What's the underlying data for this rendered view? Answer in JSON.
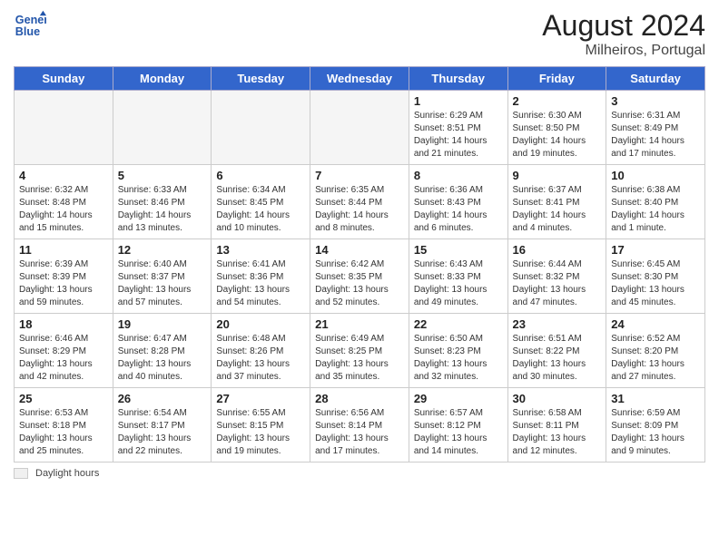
{
  "header": {
    "logo_line1": "General",
    "logo_line2": "Blue",
    "month_year": "August 2024",
    "location": "Milheiros, Portugal"
  },
  "days_of_week": [
    "Sunday",
    "Monday",
    "Tuesday",
    "Wednesday",
    "Thursday",
    "Friday",
    "Saturday"
  ],
  "weeks": [
    [
      {
        "num": "",
        "info": "",
        "empty": true
      },
      {
        "num": "",
        "info": "",
        "empty": true
      },
      {
        "num": "",
        "info": "",
        "empty": true
      },
      {
        "num": "",
        "info": "",
        "empty": true
      },
      {
        "num": "1",
        "info": "Sunrise: 6:29 AM\nSunset: 8:51 PM\nDaylight: 14 hours\nand 21 minutes.",
        "empty": false
      },
      {
        "num": "2",
        "info": "Sunrise: 6:30 AM\nSunset: 8:50 PM\nDaylight: 14 hours\nand 19 minutes.",
        "empty": false
      },
      {
        "num": "3",
        "info": "Sunrise: 6:31 AM\nSunset: 8:49 PM\nDaylight: 14 hours\nand 17 minutes.",
        "empty": false
      }
    ],
    [
      {
        "num": "4",
        "info": "Sunrise: 6:32 AM\nSunset: 8:48 PM\nDaylight: 14 hours\nand 15 minutes.",
        "empty": false
      },
      {
        "num": "5",
        "info": "Sunrise: 6:33 AM\nSunset: 8:46 PM\nDaylight: 14 hours\nand 13 minutes.",
        "empty": false
      },
      {
        "num": "6",
        "info": "Sunrise: 6:34 AM\nSunset: 8:45 PM\nDaylight: 14 hours\nand 10 minutes.",
        "empty": false
      },
      {
        "num": "7",
        "info": "Sunrise: 6:35 AM\nSunset: 8:44 PM\nDaylight: 14 hours\nand 8 minutes.",
        "empty": false
      },
      {
        "num": "8",
        "info": "Sunrise: 6:36 AM\nSunset: 8:43 PM\nDaylight: 14 hours\nand 6 minutes.",
        "empty": false
      },
      {
        "num": "9",
        "info": "Sunrise: 6:37 AM\nSunset: 8:41 PM\nDaylight: 14 hours\nand 4 minutes.",
        "empty": false
      },
      {
        "num": "10",
        "info": "Sunrise: 6:38 AM\nSunset: 8:40 PM\nDaylight: 14 hours\nand 1 minute.",
        "empty": false
      }
    ],
    [
      {
        "num": "11",
        "info": "Sunrise: 6:39 AM\nSunset: 8:39 PM\nDaylight: 13 hours\nand 59 minutes.",
        "empty": false
      },
      {
        "num": "12",
        "info": "Sunrise: 6:40 AM\nSunset: 8:37 PM\nDaylight: 13 hours\nand 57 minutes.",
        "empty": false
      },
      {
        "num": "13",
        "info": "Sunrise: 6:41 AM\nSunset: 8:36 PM\nDaylight: 13 hours\nand 54 minutes.",
        "empty": false
      },
      {
        "num": "14",
        "info": "Sunrise: 6:42 AM\nSunset: 8:35 PM\nDaylight: 13 hours\nand 52 minutes.",
        "empty": false
      },
      {
        "num": "15",
        "info": "Sunrise: 6:43 AM\nSunset: 8:33 PM\nDaylight: 13 hours\nand 49 minutes.",
        "empty": false
      },
      {
        "num": "16",
        "info": "Sunrise: 6:44 AM\nSunset: 8:32 PM\nDaylight: 13 hours\nand 47 minutes.",
        "empty": false
      },
      {
        "num": "17",
        "info": "Sunrise: 6:45 AM\nSunset: 8:30 PM\nDaylight: 13 hours\nand 45 minutes.",
        "empty": false
      }
    ],
    [
      {
        "num": "18",
        "info": "Sunrise: 6:46 AM\nSunset: 8:29 PM\nDaylight: 13 hours\nand 42 minutes.",
        "empty": false
      },
      {
        "num": "19",
        "info": "Sunrise: 6:47 AM\nSunset: 8:28 PM\nDaylight: 13 hours\nand 40 minutes.",
        "empty": false
      },
      {
        "num": "20",
        "info": "Sunrise: 6:48 AM\nSunset: 8:26 PM\nDaylight: 13 hours\nand 37 minutes.",
        "empty": false
      },
      {
        "num": "21",
        "info": "Sunrise: 6:49 AM\nSunset: 8:25 PM\nDaylight: 13 hours\nand 35 minutes.",
        "empty": false
      },
      {
        "num": "22",
        "info": "Sunrise: 6:50 AM\nSunset: 8:23 PM\nDaylight: 13 hours\nand 32 minutes.",
        "empty": false
      },
      {
        "num": "23",
        "info": "Sunrise: 6:51 AM\nSunset: 8:22 PM\nDaylight: 13 hours\nand 30 minutes.",
        "empty": false
      },
      {
        "num": "24",
        "info": "Sunrise: 6:52 AM\nSunset: 8:20 PM\nDaylight: 13 hours\nand 27 minutes.",
        "empty": false
      }
    ],
    [
      {
        "num": "25",
        "info": "Sunrise: 6:53 AM\nSunset: 8:18 PM\nDaylight: 13 hours\nand 25 minutes.",
        "empty": false
      },
      {
        "num": "26",
        "info": "Sunrise: 6:54 AM\nSunset: 8:17 PM\nDaylight: 13 hours\nand 22 minutes.",
        "empty": false
      },
      {
        "num": "27",
        "info": "Sunrise: 6:55 AM\nSunset: 8:15 PM\nDaylight: 13 hours\nand 19 minutes.",
        "empty": false
      },
      {
        "num": "28",
        "info": "Sunrise: 6:56 AM\nSunset: 8:14 PM\nDaylight: 13 hours\nand 17 minutes.",
        "empty": false
      },
      {
        "num": "29",
        "info": "Sunrise: 6:57 AM\nSunset: 8:12 PM\nDaylight: 13 hours\nand 14 minutes.",
        "empty": false
      },
      {
        "num": "30",
        "info": "Sunrise: 6:58 AM\nSunset: 8:11 PM\nDaylight: 13 hours\nand 12 minutes.",
        "empty": false
      },
      {
        "num": "31",
        "info": "Sunrise: 6:59 AM\nSunset: 8:09 PM\nDaylight: 13 hours\nand 9 minutes.",
        "empty": false
      }
    ]
  ],
  "footer": {
    "legend_label": "Daylight hours"
  }
}
